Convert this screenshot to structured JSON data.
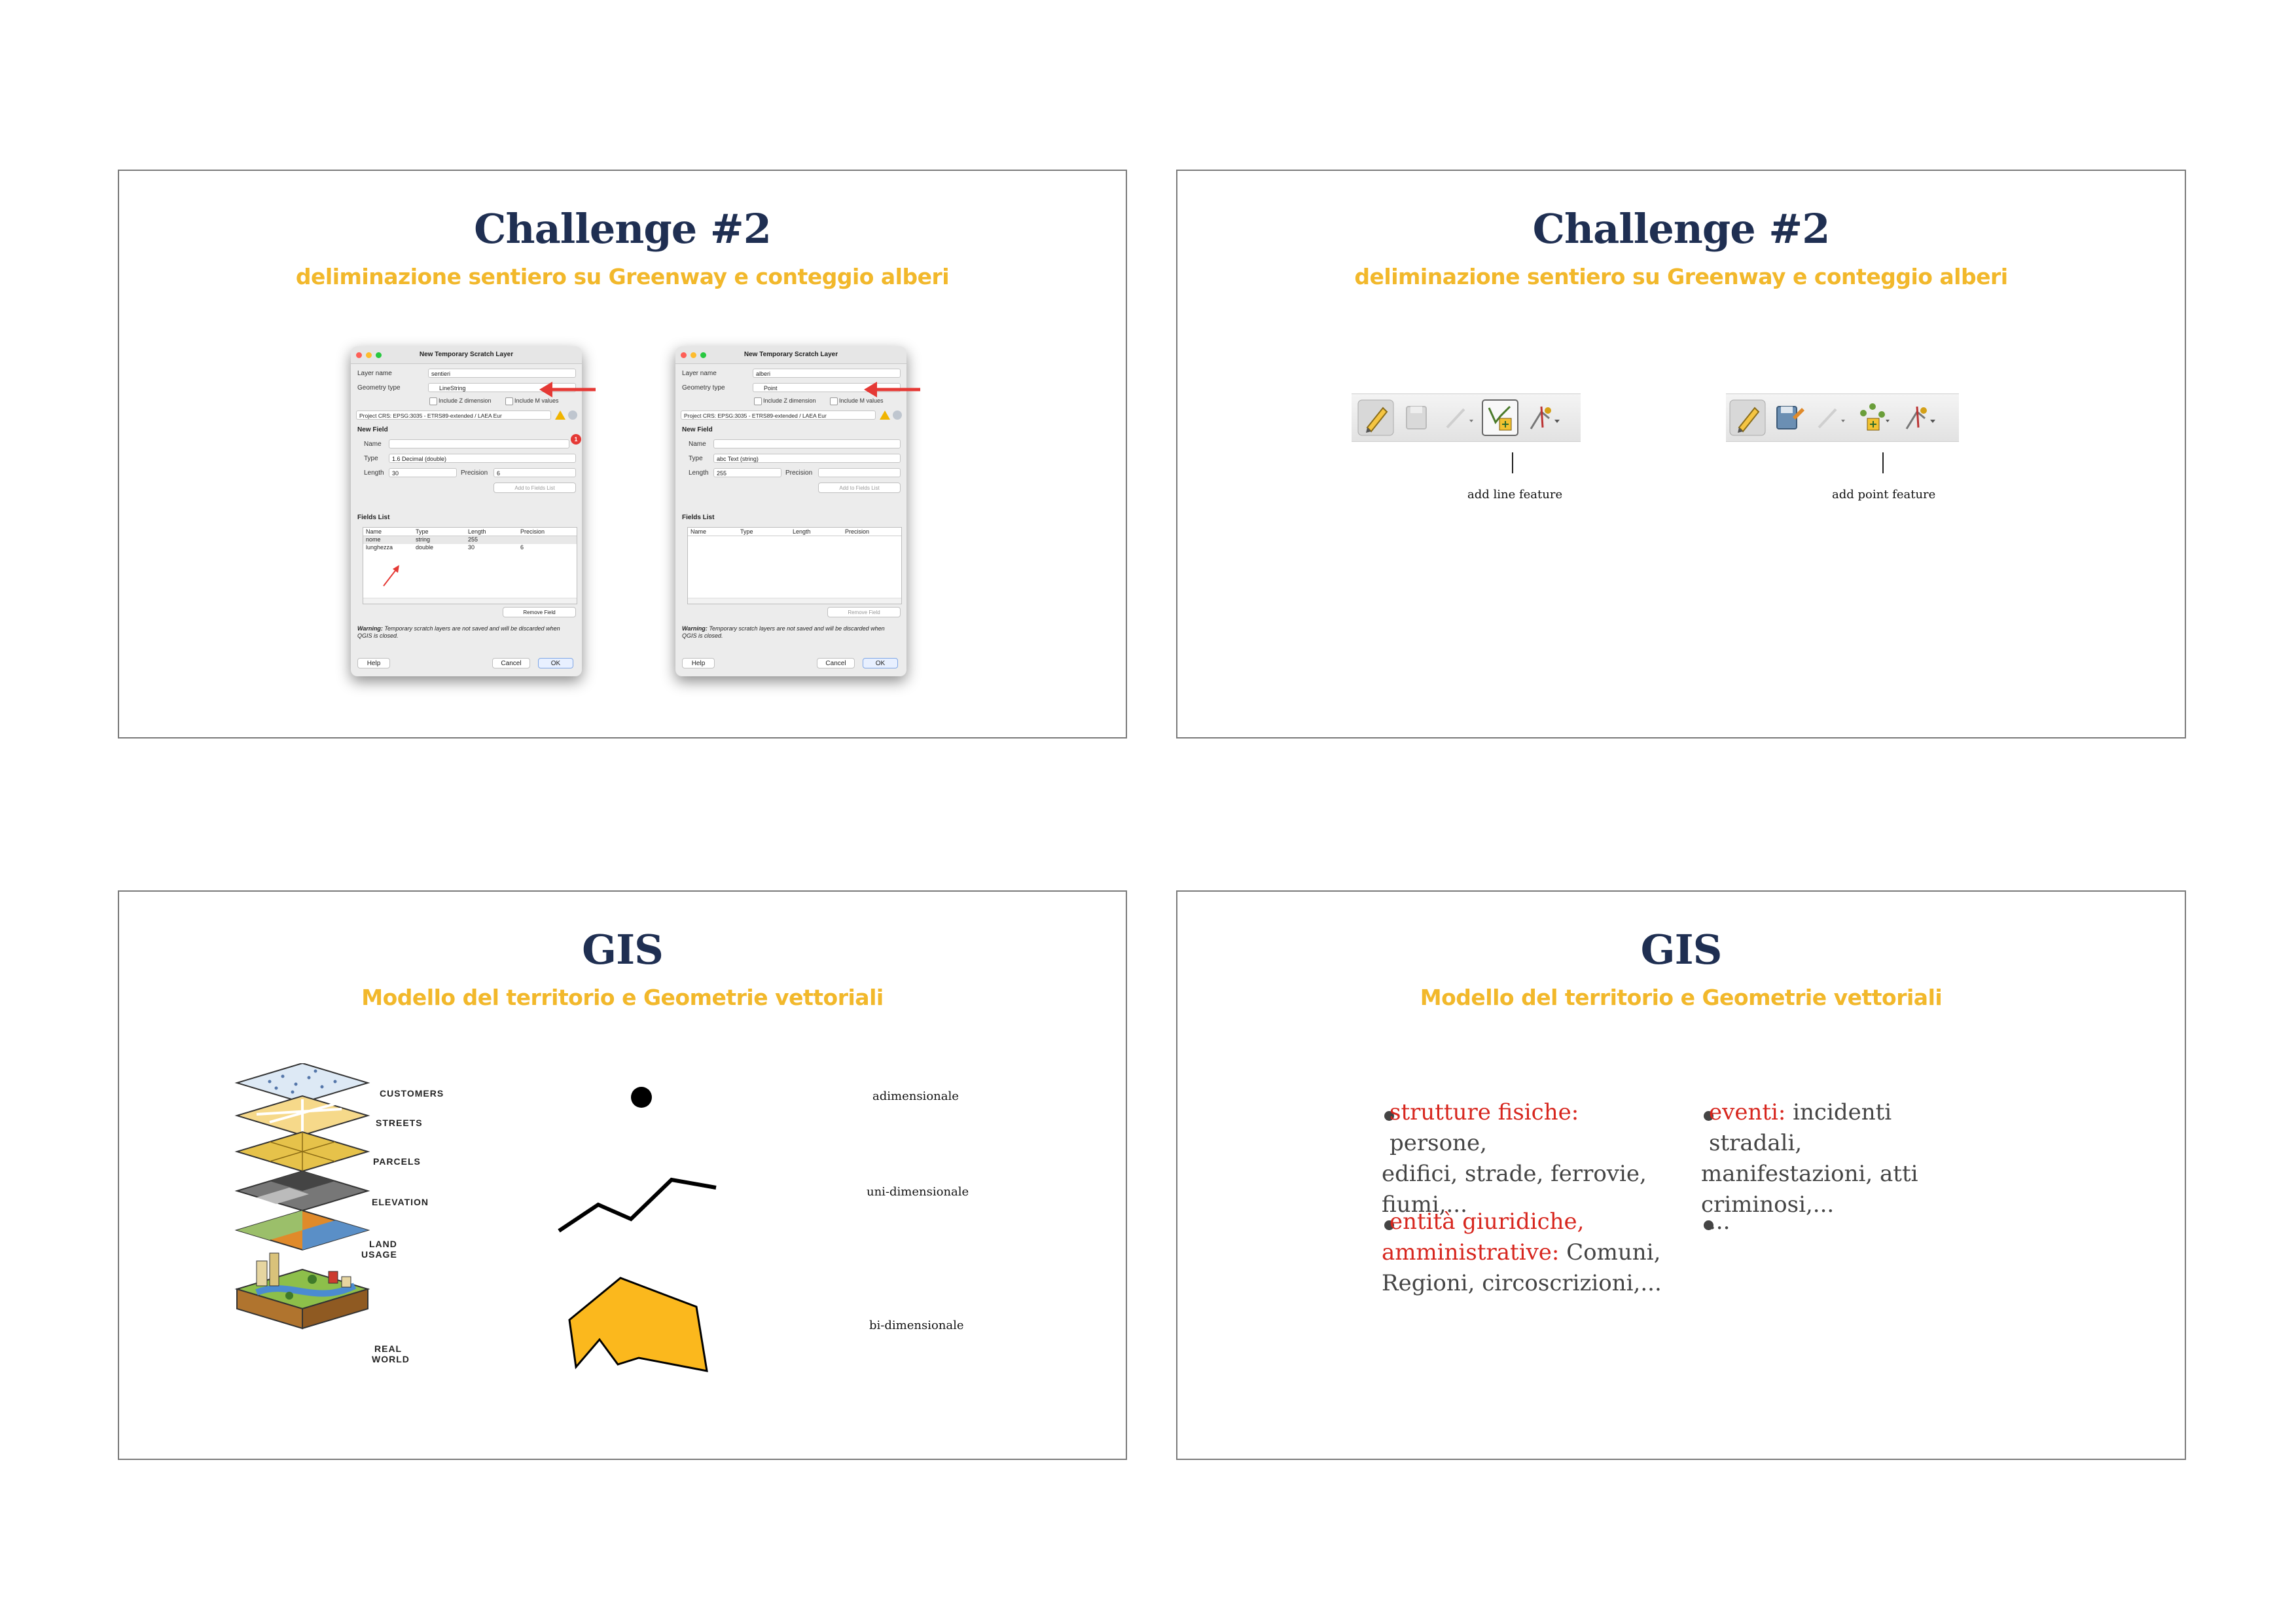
{
  "slides": [
    {
      "title": "Challenge #2",
      "subtitle": "deliminazione sentiero su Greenway e conteggio alberi",
      "dialogs": [
        {
          "window_title": "New Temporary Scratch Layer",
          "layer_name_label": "Layer name",
          "layer_name_value": "sentieri",
          "geometry_type_label": "Geometry type",
          "geometry_type_value": "LineString",
          "include_z": "Include Z dimension",
          "include_m": "Include M values",
          "crs": "Project CRS: EPSG:3035 - ETRS89-extended / LAEA Eur",
          "new_field": "New Field",
          "name_label": "Name",
          "name_value": "",
          "type_label": "Type",
          "type_value": "1.6 Decimal (double)",
          "length_label": "Length",
          "length_value": "30",
          "precision_label": "Precision",
          "precision_value": "6",
          "add_to_fields": "Add to Fields List",
          "fields_list": "Fields List",
          "columns": [
            "Name",
            "Type",
            "Length",
            "Precision"
          ],
          "rows": [
            [
              "nome",
              "string",
              "255",
              ""
            ],
            [
              "lunghezza",
              "double",
              "30",
              "6"
            ]
          ],
          "remove_field": "Remove Field",
          "warning_bold": "Warning:",
          "warning_text": "Temporary scratch layers are not saved and will be discarded when QGIS is closed.",
          "help": "Help",
          "cancel": "Cancel",
          "ok": "OK",
          "badge": "1"
        },
        {
          "window_title": "New Temporary Scratch Layer",
          "layer_name_label": "Layer name",
          "layer_name_value": "alberi",
          "geometry_type_label": "Geometry type",
          "geometry_type_value": "Point",
          "include_z": "Include Z dimension",
          "include_m": "Include M values",
          "crs": "Project CRS: EPSG:3035 - ETRS89-extended / LAEA Eur",
          "new_field": "New Field",
          "name_label": "Name",
          "name_value": "",
          "type_label": "Type",
          "type_value": "abc Text (string)",
          "length_label": "Length",
          "length_value": "255",
          "precision_label": "Precision",
          "precision_value": "",
          "add_to_fields": "Add to Fields List",
          "fields_list": "Fields List",
          "columns": [
            "Name",
            "Type",
            "Length",
            "Precision"
          ],
          "remove_field": "Remove Field",
          "warning_bold": "Warning:",
          "warning_text": "Temporary scratch layers are not saved and will be discarded when QGIS is closed.",
          "help": "Help",
          "cancel": "Cancel",
          "ok": "OK"
        }
      ]
    },
    {
      "title": "Challenge #2",
      "subtitle": "deliminazione sentiero su Greenway e conteggio alberi",
      "captions": [
        "add line feature",
        "add point feature"
      ]
    },
    {
      "title": "GIS",
      "subtitle": "Modello del territorio e Geometrie vettoriali",
      "layer_labels": [
        "CUSTOMERS",
        "STREETS",
        "PARCELS",
        "ELEVATION",
        "LAND",
        "USAGE",
        "REAL",
        "WORLD"
      ],
      "geometry_labels": [
        "adimensionale",
        "uni-dimensionale",
        "bi-dimensionale"
      ],
      "polygon_color": "#fbb81d"
    },
    {
      "title": "GIS",
      "subtitle": "Modello del territorio e Geometrie vettoriali",
      "bullets": {
        "b1_hl": "strutture fisiche:",
        "b1_l1": "persone,",
        "b1_l2": "edifici, strade, ferrovie,",
        "b1_l3": "fiumi,...",
        "b2_hl1": "entità giuridiche,",
        "b2_hl2": "amministrative:",
        "b2_l2": "Comuni,",
        "b2_l3": "Regioni, circoscrizioni,...",
        "b3_hl": "eventi:",
        "b3_l1": "incidenti stradali,",
        "b3_l2": "manifestazioni, atti",
        "b3_l3": "criminosi,...",
        "b4": "..."
      },
      "highlight_color": "#d7261e"
    }
  ]
}
